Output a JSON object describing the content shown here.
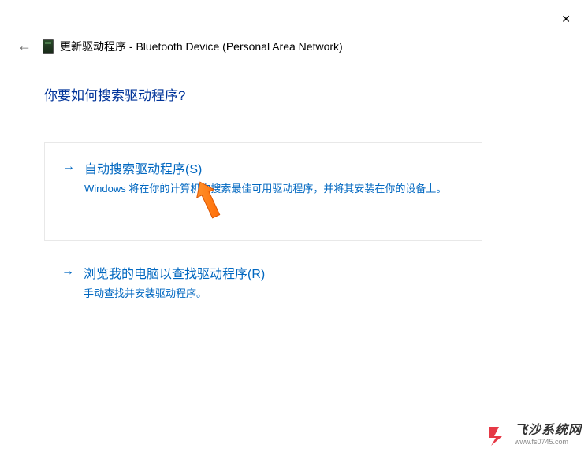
{
  "window": {
    "close": "✕"
  },
  "header": {
    "title": "更新驱动程序 - Bluetooth Device (Personal Area Network)"
  },
  "question": "你要如何搜索驱动程序?",
  "options": {
    "auto": {
      "title": "自动搜索驱动程序(S)",
      "desc": "Windows 将在你的计算机中搜索最佳可用驱动程序，并将其安装在你的设备上。"
    },
    "browse": {
      "title": "浏览我的电脑以查找驱动程序(R)",
      "desc": "手动查找并安装驱动程序。"
    }
  },
  "watermark": {
    "title": "飞沙系统网",
    "url": "www.fs0745.com"
  }
}
